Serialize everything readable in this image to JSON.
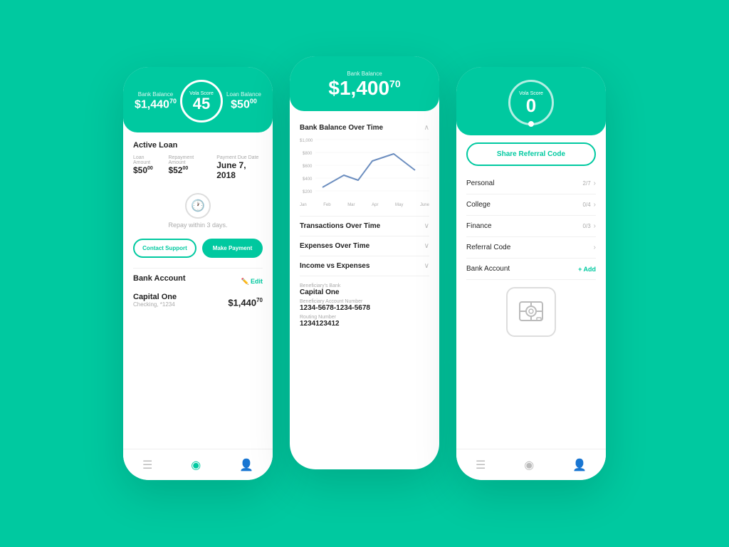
{
  "bg_color": "#00c9a0",
  "phone1": {
    "header": {
      "bank_balance_label": "Bank Balance",
      "bank_balance": "$1,440",
      "bank_balance_cents": "70",
      "score_label": "Vola Score",
      "score": "45",
      "loan_balance_label": "Loan Balance",
      "loan_balance": "$50",
      "loan_balance_cents": "00"
    },
    "active_loan_title": "Active Loan",
    "loan_amount_label": "Loan Amount",
    "loan_amount": "$50",
    "loan_amount_cents": "00",
    "repayment_label": "Repayment Amount",
    "repayment": "$52",
    "repayment_cents": "00",
    "due_date_label": "Payment Due Date",
    "due_date": "June 7, 2018",
    "repay_text": "Repay within 3 days.",
    "contact_btn": "Contact Support",
    "payment_btn": "Make Payment",
    "bank_account_title": "Bank Account",
    "edit_label": "Edit",
    "bank_name": "Capital One",
    "bank_sub": "Checking, *1234",
    "bank_balance2": "$1,440",
    "bank_balance2_cents": "70",
    "nav": [
      "receipt-icon",
      "chart-icon",
      "user-icon"
    ]
  },
  "phone2": {
    "header": {
      "label": "Bank Balance",
      "value": "$1,400",
      "cents": "70"
    },
    "chart_title": "Bank Balance Over Time",
    "chart_y_labels": [
      "$1,000",
      "$800",
      "$600",
      "$400",
      "$200"
    ],
    "chart_x_labels": [
      "Jan",
      "Feb",
      "Mar",
      "Apr",
      "May",
      "June"
    ],
    "sections": [
      {
        "label": "Transactions Over Time",
        "collapsed": true
      },
      {
        "label": "Expenses Over Time",
        "collapsed": true
      },
      {
        "label": "Income vs Expenses",
        "collapsed": true
      }
    ],
    "bank_info": {
      "beneficiary_bank_label": "Beneficiary's Bank",
      "beneficiary_bank": "Capital One",
      "account_number_label": "Beneficiary Account Number",
      "account_number": "1234-5678-1234-5678",
      "routing_label": "Routing Number",
      "routing": "1234123412"
    }
  },
  "phone3": {
    "score_label": "Vola Score",
    "score": "0",
    "share_referral_btn": "Share Referral Code",
    "menu_items": [
      {
        "label": "Personal",
        "badge": "2/7",
        "has_chevron": true
      },
      {
        "label": "College",
        "badge": "0/4",
        "has_chevron": true
      },
      {
        "label": "Finance",
        "badge": "0/3",
        "has_chevron": true
      },
      {
        "label": "Referral Code",
        "badge": "",
        "has_chevron": true
      },
      {
        "label": "Bank Account",
        "add": "+ Add",
        "has_chevron": false
      }
    ],
    "nav": [
      "receipt-icon",
      "chart-icon",
      "user-icon"
    ]
  }
}
